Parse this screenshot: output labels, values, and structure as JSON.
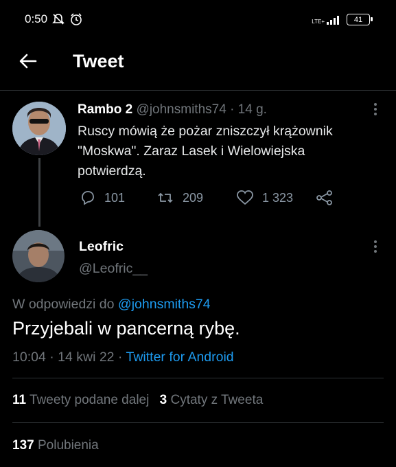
{
  "status_bar": {
    "time": "0:50",
    "network": "LTE+",
    "battery": "41"
  },
  "header": {
    "title": "Tweet"
  },
  "parent_tweet": {
    "display_name": "Rambo 2",
    "handle": "@johnsmiths74",
    "separator": "·",
    "time_ago": "14 g.",
    "text": "Ruscy mówią że pożar zniszczył krążownik \"Moskwa\". Zaraz Lasek i Wielowiejska potwierdzą.",
    "replies": "101",
    "retweets": "209",
    "likes": "1 323"
  },
  "main_tweet": {
    "display_name": "Leofric",
    "handle": "@Leofric__",
    "reply_prefix": "W odpowiedzi do",
    "reply_to": "@johnsmiths74",
    "text": "Przyjebali w pancerną rybę.",
    "timestamp": "10:04 · 14 kwi 22 ·",
    "source": "Twitter for Android"
  },
  "stats": {
    "retweets_count": "11",
    "retweets_label": "Tweety podane dalej",
    "quotes_count": "3",
    "quotes_label": "Cytaty z Tweeta",
    "likes_count": "137",
    "likes_label": "Polubienia"
  },
  "colors": {
    "background": "#000000",
    "accent": "#1d9bf0",
    "muted": "#71767b"
  }
}
